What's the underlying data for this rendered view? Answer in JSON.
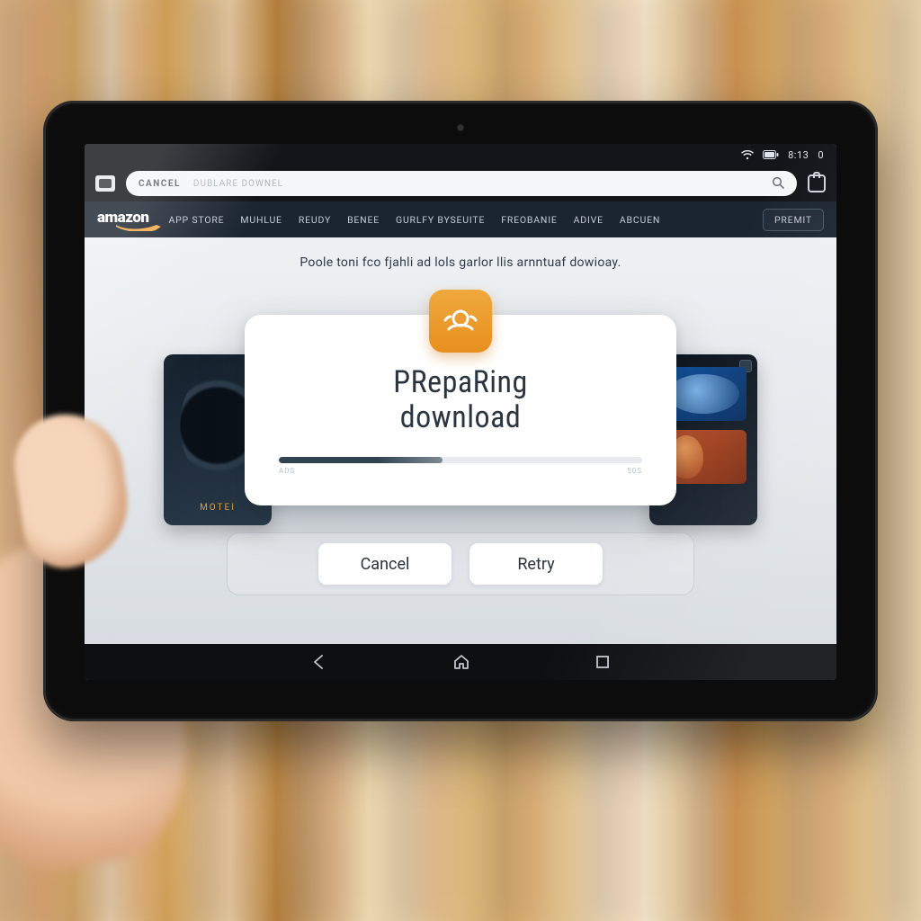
{
  "status": {
    "time": "8:13",
    "batt_icon": "battery-icon",
    "wifi_icon": "wifi-icon",
    "extra": "0"
  },
  "urlbar": {
    "cancel": "CANCEL",
    "placeholder": "DUBLARE DOWNEL"
  },
  "brand": "amazon",
  "nav": {
    "items": [
      "APP STORE",
      "MUHLUE",
      "REUDY",
      "BENEE",
      "GURLFY BYSEUITE",
      "FREOBANIE",
      "ADIVE",
      "ABCUEN"
    ],
    "cta": "PREMIT"
  },
  "subtitle": "Poole toni fco fjahli ad lols garlor llis arnntuaf dowioay.",
  "dialog": {
    "title_l1": "PRepaRing",
    "title_l2": "download",
    "progress_pct": 45,
    "label_left": "ADS",
    "label_right": "50S"
  },
  "carousel": {
    "left_tag": "MOTEI"
  },
  "buttons": {
    "cancel": "Cancel",
    "retry": "Retry"
  },
  "colors": {
    "accent": "#e9962a",
    "navbg": "#1b2531"
  }
}
